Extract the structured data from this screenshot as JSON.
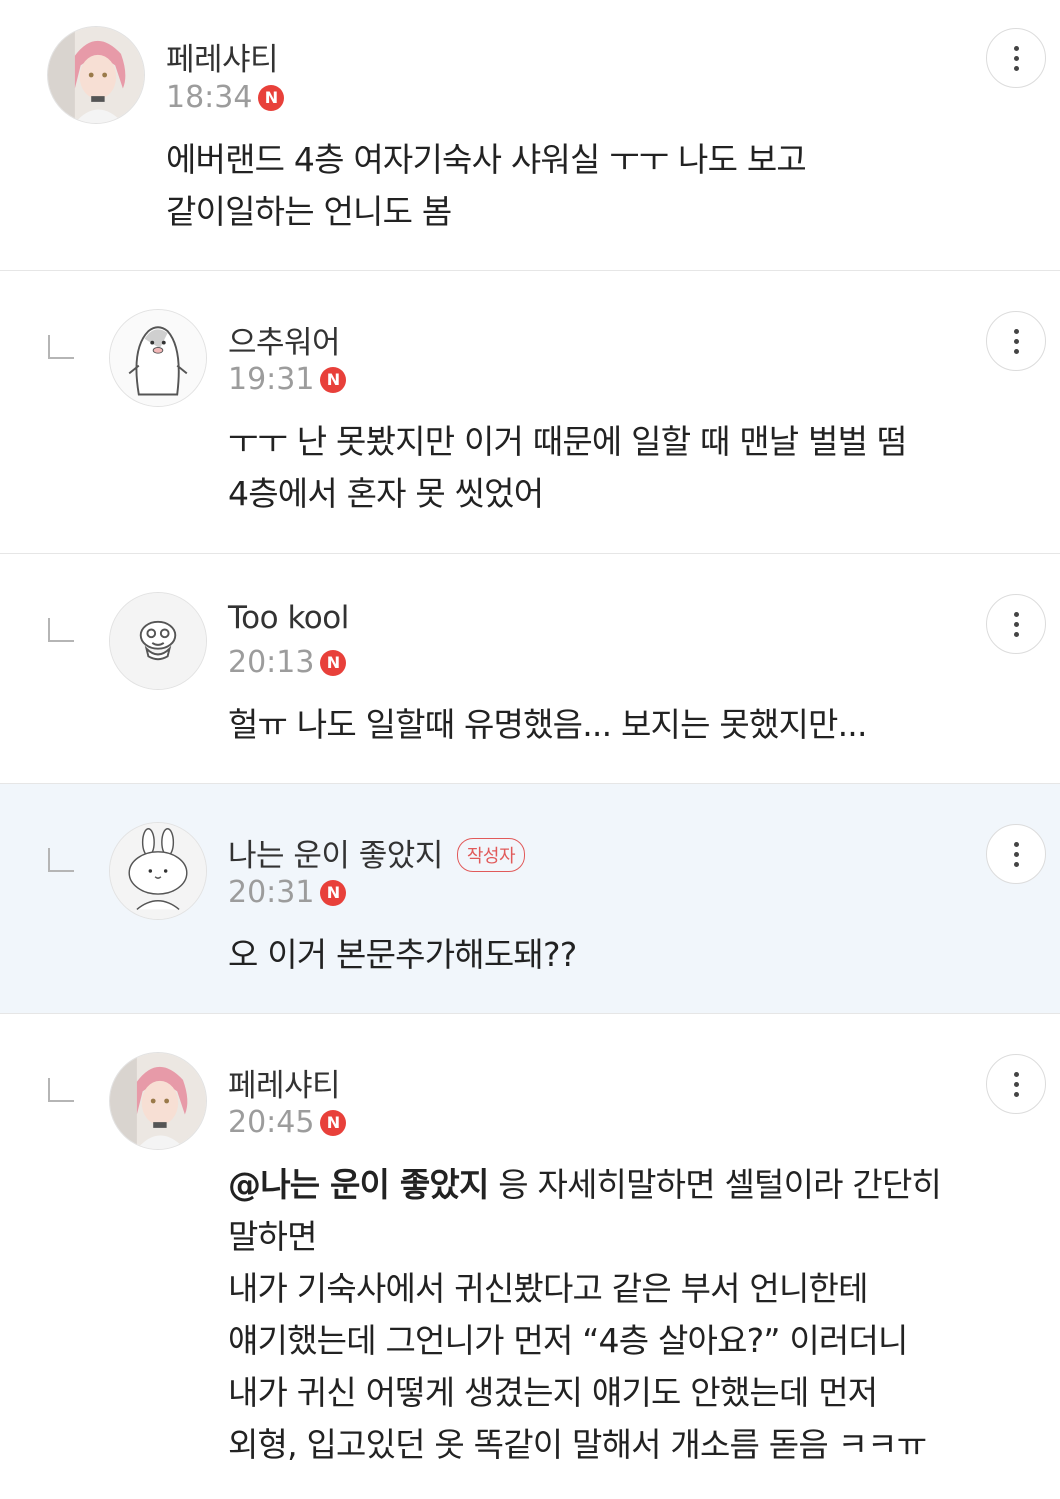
{
  "comments": [
    {
      "nickname": "페레샤티",
      "time": "18:34",
      "new_badge": "N",
      "avatar": "profile-photo-icon",
      "lines": [
        "에버랜드 4층 여자기숙사 샤워실 ㅜㅜ 나도 보고",
        "같이일하는 언니도 봄"
      ]
    },
    {
      "nickname": "으추워어",
      "time": "19:31",
      "new_badge": "N",
      "avatar": "penguin-icon",
      "lines": [
        "ㅜㅜ 난 못봤지만 이거 때문에 일할 때 맨날 벌벌 떰",
        "4층에서 혼자 못 씻었어"
      ]
    },
    {
      "nickname": "Too kool",
      "time": "20:13",
      "new_badge": "N",
      "avatar": "cartoon-character-icon",
      "lines": [
        "헐ㅠ 나도 일할때 유명했음... 보지는 못했지만..."
      ]
    },
    {
      "nickname": "나는 운이 좋았지",
      "author_badge": "작성자",
      "time": "20:31",
      "new_badge": "N",
      "avatar": "bunny-icon",
      "lines": [
        "오 이거 본문추가해도돼??"
      ]
    },
    {
      "nickname": "페레샤티",
      "time": "20:45",
      "new_badge": "N",
      "avatar": "profile-photo-icon",
      "mention": "@나는 운이 좋았지",
      "first_line_rest": " 응 자세히말하면 셀털이라 간단히",
      "lines": [
        "말하면",
        "내가 기숙사에서 귀신봤다고 같은 부서 언니한테",
        "얘기했는데 그언니가 먼저 “4층 살아요?” 이러더니",
        "내가 귀신 어떻게 생겼는지 얘기도 안했는데 먼저",
        "외형, 입고있던 옷 똑같이 말해서 개소름 돋음 ㅋㅋㅠ"
      ]
    }
  ],
  "more_icon": "more-vertical-icon",
  "colors": {
    "new_badge": "#e8403a",
    "author_badge": "#e15a5a",
    "highlight_bg": "#f1f6fb"
  }
}
